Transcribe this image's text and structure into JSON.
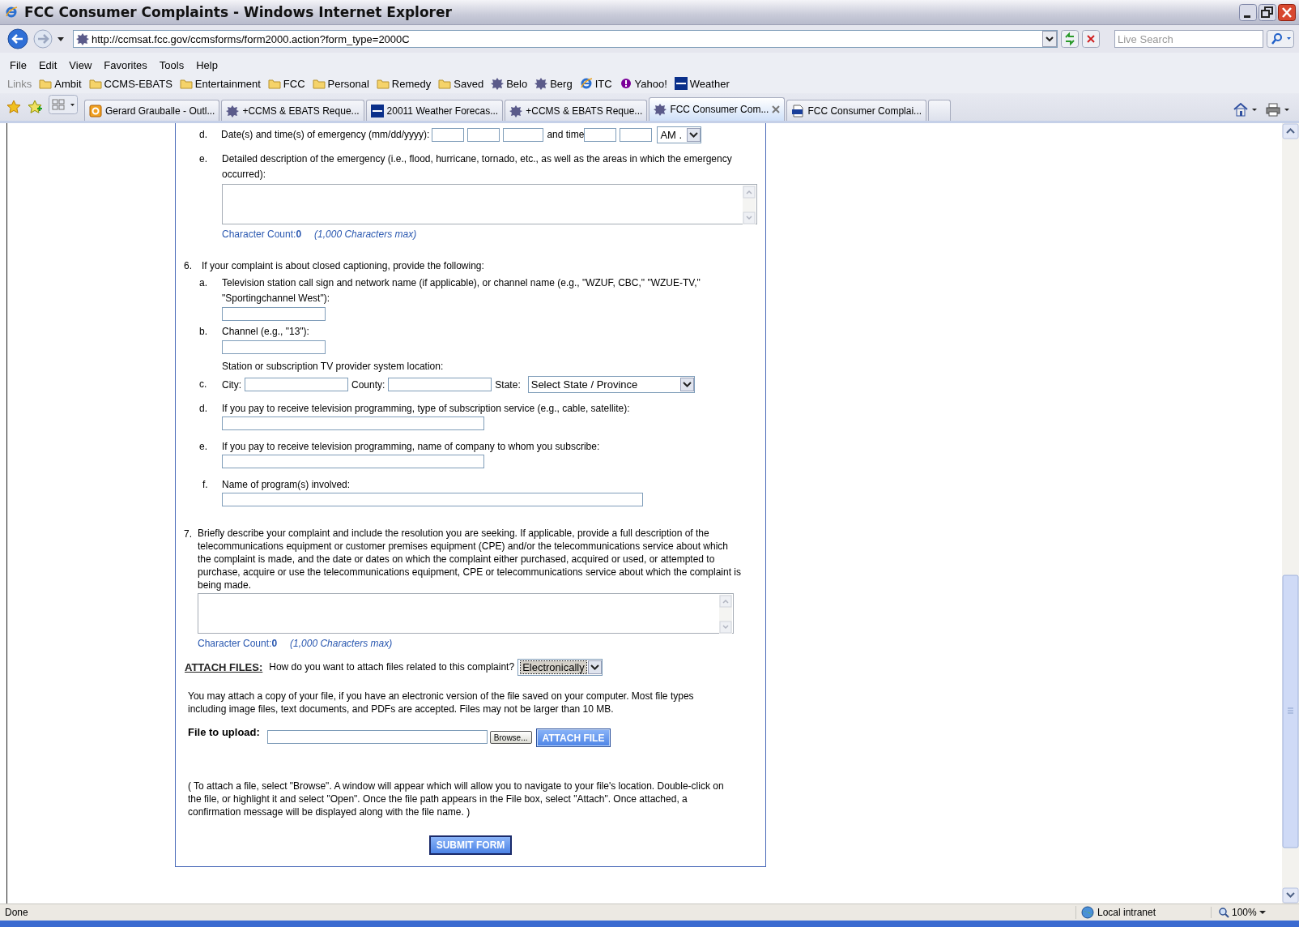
{
  "window": {
    "title": "FCC Consumer Complaints - Windows Internet Explorer"
  },
  "address_bar": {
    "url": "http://ccmsat.fcc.gov/ccmsforms/form2000.action?form_type=2000C",
    "search_placeholder": "Live Search"
  },
  "menu": [
    "File",
    "Edit",
    "View",
    "Favorites",
    "Tools",
    "Help"
  ],
  "links": {
    "label": "Links",
    "items": [
      {
        "kind": "folder",
        "label": "Ambit"
      },
      {
        "kind": "folder",
        "label": "CCMS-EBATS"
      },
      {
        "kind": "folder",
        "label": "Entertainment"
      },
      {
        "kind": "folder",
        "label": "FCC"
      },
      {
        "kind": "folder",
        "label": "Personal"
      },
      {
        "kind": "folder",
        "label": "Remedy"
      },
      {
        "kind": "folder",
        "label": "Saved"
      },
      {
        "kind": "site",
        "label": "Belo"
      },
      {
        "kind": "site",
        "label": "Berg"
      },
      {
        "kind": "ie",
        "label": "ITC"
      },
      {
        "kind": "yahoo",
        "label": "Yahoo!"
      },
      {
        "kind": "twc",
        "label": "Weather"
      }
    ]
  },
  "tabs": [
    {
      "kind": "mail",
      "label": "Gerard Grauballe - Outl...",
      "selected": false
    },
    {
      "kind": "site",
      "label": "+CCMS & EBATS Reque...",
      "selected": false
    },
    {
      "kind": "twc",
      "label": "20011 Weather Forecas...",
      "selected": false
    },
    {
      "kind": "site",
      "label": "+CCMS & EBATS Reque...",
      "selected": false
    },
    {
      "kind": "site",
      "label": "FCC Consumer Com...",
      "selected": true
    },
    {
      "kind": "document",
      "label": "FCC Consumer Complai...",
      "selected": false
    }
  ],
  "form": {
    "emergency_date": {
      "marker": "d.",
      "label": "Date(s) and time(s) of emergency (mm/dd/yyyy):",
      "time_label": "and time",
      "ampm": "AM ."
    },
    "emergency_description": {
      "marker": "e.",
      "label": "Detailed description of the emergency (i.e., flood, hurricane, tornado, etc., as well as the areas in which the emergency occurred):",
      "count_label": "Character Count:",
      "count": "0",
      "max": "(1,000 Characters max)"
    },
    "captioning": {
      "number": "6.",
      "heading": "If your complaint is about closed captioning, provide the following:",
      "items": [
        {
          "kind": "inline",
          "marker": "a.",
          "label": "Television station call sign and network name (if applicable), or channel name (e.g., \"WZUF, CBC,\" \"WZUE-TV,\" \"Sportingchannel West\"):"
        },
        {
          "kind": "inline",
          "marker": "b.",
          "label": "Channel (e.g., \"13\"):"
        },
        {
          "kind": "location",
          "marker": "c.",
          "label": "Station or subscription TV provider system location:",
          "city": "City:",
          "county": "County:",
          "state": "State:",
          "state_value": "Select State / Province"
        },
        {
          "kind": "below",
          "marker": "d.",
          "label": "If you pay to receive television programming, type of subscription service (e.g., cable, satellite):"
        },
        {
          "kind": "below",
          "marker": "e.",
          "label": "If you pay to receive television programming, name of company to whom you subscribe:"
        },
        {
          "kind": "below_wide",
          "marker": "f.",
          "label": "Name of program(s) involved:"
        }
      ]
    },
    "description": {
      "number": "7.",
      "text": "Briefly describe your complaint and include the resolution you are seeking. If applicable, provide a full description of the telecommunications equipment or customer premises equipment (CPE) and/or the telecommunications service about which the complaint is made, and the date or dates on which the complaint either purchased, acquired or used, or attempted to purchase, acquire or use the telecommunications equipment, CPE or telecommunications service about which the complaint is being made.",
      "count_label": "Character Count:",
      "count": "0",
      "max": "(1,000 Characters max)"
    },
    "attach": {
      "heading": "ATTACH FILES:",
      "question": "How do you want to attach files related to this complaint?",
      "method": "Electronically",
      "info": "You may attach a copy of your file, if you have an electronic version of the file saved on your computer. Most file types including image files, text documents, and PDFs are accepted. Files may not be larger than 10 MB.",
      "upload_label": "File to upload:",
      "browse": "Browse...",
      "attach_button": "ATTACH FILE",
      "note": "( To attach a file, select \"Browse\". A window will appear which will allow you to navigate to your file's location. Double-click on the file, or highlight it and select \"Open\". Once the file path appears in the File box, select \"Attach\". Once attached, a confirmation message will be displayed along with the file name. )"
    },
    "submit": "SUBMIT FORM"
  },
  "status_bar": {
    "text": "Done",
    "zone": "Local intranet",
    "zoom": "100%"
  }
}
